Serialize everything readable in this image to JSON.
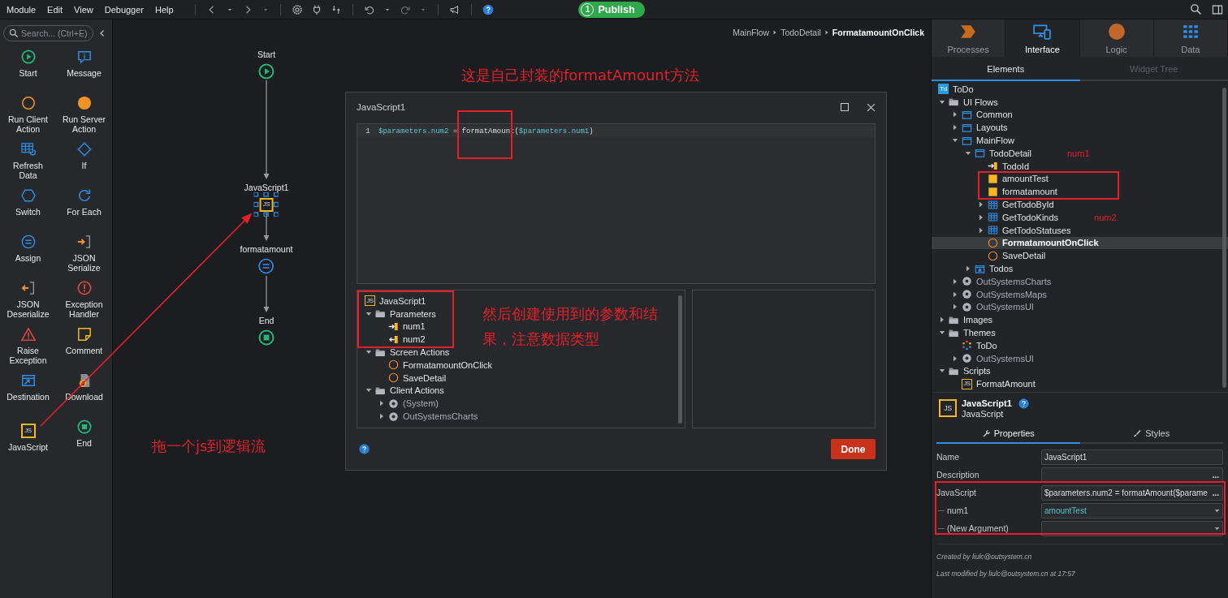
{
  "menu": [
    "Module",
    "Edit",
    "View",
    "Debugger",
    "Help"
  ],
  "publish": {
    "count": "1",
    "label": "Publish"
  },
  "toolbox": {
    "search_placeholder": "Search... (Ctrl+E)",
    "tools": [
      {
        "label": "Start",
        "kind": "start"
      },
      {
        "label": "Message",
        "kind": "message"
      },
      {
        "label": "Run Client Action",
        "kind": "run-client"
      },
      {
        "label": "Run Server Action",
        "kind": "run-server"
      },
      {
        "label": "Refresh Data",
        "kind": "refresh"
      },
      {
        "label": "If",
        "kind": "if"
      },
      {
        "label": "Switch",
        "kind": "switch"
      },
      {
        "label": "For Each",
        "kind": "foreach"
      },
      {
        "label": "Assign",
        "kind": "assign"
      },
      {
        "label": "JSON Serialize",
        "kind": "json-serialize"
      },
      {
        "label": "JSON Deserialize",
        "kind": "json-deserialize"
      },
      {
        "label": "Exception Handler",
        "kind": "exception"
      },
      {
        "label": "Raise Exception",
        "kind": "raise"
      },
      {
        "label": "Comment",
        "kind": "comment"
      },
      {
        "label": "Destination",
        "kind": "destination"
      },
      {
        "label": "Download",
        "kind": "download"
      },
      {
        "label": "JavaScript",
        "kind": "js",
        "badge": "JS"
      },
      {
        "label": "End",
        "kind": "end"
      }
    ]
  },
  "breadcrumb": [
    "MainFlow",
    "TodoDetail",
    "FormatamountOnClick"
  ],
  "flow": {
    "nodes": [
      {
        "label": "Start",
        "kind": "start",
        "selected": false
      },
      {
        "label": "JavaScript1",
        "kind": "js",
        "badge": "JS",
        "selected": true
      },
      {
        "label": "formatamount",
        "kind": "assign",
        "selected": false
      },
      {
        "label": "End",
        "kind": "end",
        "selected": false
      }
    ]
  },
  "annotations": [
    "这是自己封装的formatAmount方法",
    "拖一个js到逻辑流"
  ],
  "dialog": {
    "title": "JavaScript1",
    "code": {
      "line_number": "1",
      "tokens": [
        {
          "text": "$parameters.num2",
          "kind": "variable"
        },
        {
          "text": " = formatAmount(",
          "kind": "plain"
        },
        {
          "text": "$parameters.num1",
          "kind": "variable"
        },
        {
          "text": ")",
          "kind": "plain"
        }
      ]
    },
    "tree": [
      {
        "label": "JavaScript1",
        "kind": "js",
        "badge": "JS"
      },
      {
        "label": "Parameters",
        "kind": "folder",
        "expanded": true,
        "children": [
          {
            "label": "num1",
            "kind": "in-param"
          },
          {
            "label": "num2",
            "kind": "out-param"
          }
        ]
      },
      {
        "label": "Screen Actions",
        "kind": "folder",
        "expanded": true,
        "children": [
          {
            "label": "FormatamountOnClick",
            "kind": "action"
          },
          {
            "label": "SaveDetail",
            "kind": "action"
          }
        ]
      },
      {
        "label": "Client Actions",
        "kind": "folder",
        "expanded": true,
        "children": [
          {
            "label": "(System)",
            "kind": "dependency",
            "expanded": false
          },
          {
            "label": "OutSystemsCharts",
            "kind": "dependency",
            "expanded": false
          }
        ]
      }
    ],
    "note": "然后创建使用到的参数和结果，注意数据类型",
    "done": "Done"
  },
  "right_panel": {
    "tabs": [
      {
        "label": "Processes",
        "kind": "processes",
        "selected": false
      },
      {
        "label": "Interface",
        "kind": "interface",
        "selected": true
      },
      {
        "label": "Logic",
        "kind": "logic",
        "selected": false
      },
      {
        "label": "Data",
        "kind": "data",
        "selected": false
      }
    ],
    "subtabs": [
      {
        "label": "Elements",
        "selected": true,
        "disabled": false
      },
      {
        "label": "Widget Tree",
        "selected": false,
        "disabled": true
      }
    ],
    "tree": [
      {
        "label": "ToDo",
        "kind": "module",
        "badge": "Td",
        "selected": false
      },
      {
        "label": "UI Flows",
        "kind": "folder",
        "expanded": true,
        "selected": false,
        "children": [
          {
            "label": "Common",
            "kind": "flow",
            "expanded": false,
            "selected": false
          },
          {
            "label": "Layouts",
            "kind": "flow",
            "expanded": false,
            "selected": false
          },
          {
            "label": "MainFlow",
            "kind": "flow",
            "expanded": true,
            "selected": false,
            "children": [
              {
                "label": "TodoDetail",
                "kind": "screen",
                "expanded": true,
                "selected": false,
                "note": "num1",
                "children": [
                  {
                    "label": "TodoId",
                    "kind": "in-param",
                    "selected": false
                  },
                  {
                    "label": "amountTest",
                    "kind": "variable",
                    "selected": false
                  },
                  {
                    "label": "formatamount",
                    "kind": "variable",
                    "selected": false
                  },
                  {
                    "label": "GetTodoById",
                    "kind": "aggregate",
                    "expanded": false,
                    "selected": false
                  },
                  {
                    "label": "GetTodoKinds",
                    "kind": "aggregate",
                    "expanded": false,
                    "selected": false,
                    "note": "num2"
                  },
                  {
                    "label": "GetTodoStatuses",
                    "kind": "aggregate",
                    "expanded": false,
                    "selected": false
                  },
                  {
                    "label": "FormatamountOnClick",
                    "kind": "action",
                    "selected": true
                  },
                  {
                    "label": "SaveDetail",
                    "kind": "action",
                    "selected": false
                  }
                ]
              },
              {
                "label": "Todos",
                "kind": "block",
                "expanded": false,
                "selected": false
              }
            ]
          },
          {
            "label": "OutSystemsCharts",
            "kind": "dependency",
            "expanded": false,
            "selected": false
          },
          {
            "label": "OutSystemsMaps",
            "kind": "dependency",
            "expanded": false,
            "selected": false
          },
          {
            "label": "OutSystemsUI",
            "kind": "dependency",
            "expanded": false,
            "selected": false
          }
        ]
      },
      {
        "label": "Images",
        "kind": "folder",
        "expanded": false,
        "selected": false
      },
      {
        "label": "Themes",
        "kind": "folder",
        "expanded": true,
        "selected": false,
        "children": [
          {
            "label": "ToDo",
            "kind": "theme",
            "selected": false
          },
          {
            "label": "OutSystemsUI",
            "kind": "dependency",
            "expanded": false,
            "selected": false
          }
        ]
      },
      {
        "label": "Scripts",
        "kind": "folder",
        "expanded": true,
        "selected": false,
        "children": [
          {
            "label": "FormatAmount",
            "kind": "js",
            "badge": "JS",
            "selected": false
          }
        ]
      }
    ],
    "selection": {
      "name": "JavaScript1",
      "type": "JavaScript",
      "badge": "JS"
    },
    "prop_tabs": [
      {
        "label": "Properties",
        "kind": "wrench",
        "selected": true
      },
      {
        "label": "Styles",
        "kind": "brush",
        "selected": false
      }
    ],
    "properties": [
      {
        "label": "Name",
        "kind": "text",
        "value": "JavaScript1"
      },
      {
        "label": "Description",
        "kind": "text",
        "more": "..."
      },
      {
        "label": "JavaScript",
        "kind": "text",
        "value": "$parameters.num2 = formatAmount($parame",
        "more": "...",
        "children": [
          {
            "label": "num1",
            "kind": "select",
            "value": "amountTest"
          },
          {
            "label": "(New Argument)",
            "kind": "select"
          }
        ]
      }
    ],
    "created": "Created by liulc@outsystem.cn",
    "modified": "Last modified by liulc@outsystem.cn at 17:57"
  }
}
